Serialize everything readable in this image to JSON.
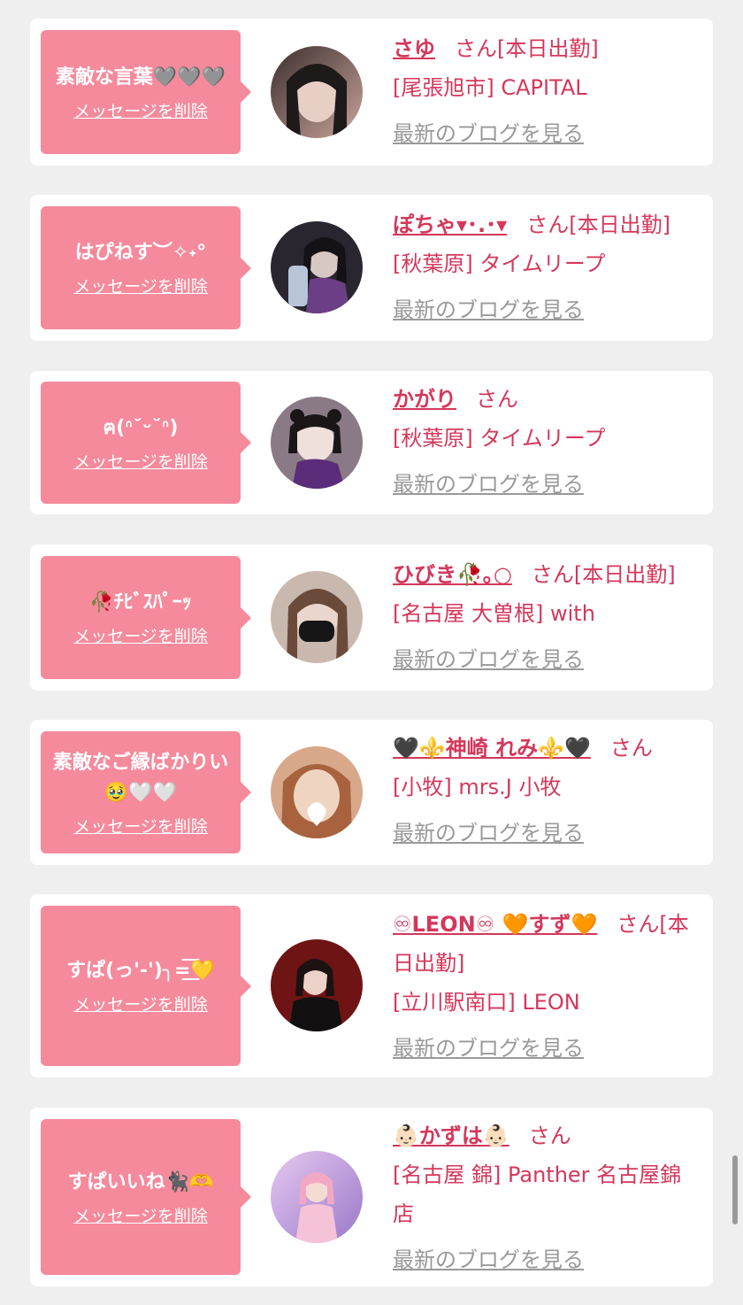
{
  "theme": {
    "accent": "#d4375b",
    "bubble": "#f58a9c",
    "link_gray": "#999999",
    "background": "#efefef"
  },
  "labels": {
    "delete": "メッセージを削除",
    "blog": "最新のブログを見る"
  },
  "items": [
    {
      "message": "素敵な言葉🩶🩶🩶",
      "name": "さゆ",
      "suffix": "さん[本日出勤]",
      "shop": "[尾張旭市] CAPITAL"
    },
    {
      "message": "はぴねす︶✧˖°",
      "name": "ぽちゃ▾･.･▾",
      "suffix": "さん[本日出勤]",
      "shop": "[秋葉原] タイムリープ"
    },
    {
      "message": "ฅ(ᐢ˘ᵕ˘ᐢ)",
      "name": "かがり",
      "suffix": "さん",
      "shop": "[秋葉原] タイムリープ"
    },
    {
      "message": "🥀ﾁﾋﾞｽﾊﾟｰｯ",
      "name": "ひびき🥀｡○",
      "suffix": "さん[本日出勤]",
      "shop": "[名古屋 大曽根] with"
    },
    {
      "message": "素敵なご縁ばかりい🥹🤍🤍",
      "name": "🖤⚜️神崎 れみ⚜️🖤",
      "suffix": "さん",
      "shop": "[小牧] mrs.J 小牧"
    },
    {
      "message": "すぱ(っ'-')╮=͟͟͞͞💛",
      "name": "♾LEON♾ 🧡すず🧡",
      "suffix": "さん[本日出勤]",
      "shop": "[立川駅南口] LEON"
    },
    {
      "message": "すぱいいね🐈‍⬛🫶",
      "name": "👶🏻かずは👶🏻",
      "suffix": "さん",
      "shop": "[名古屋 錦] Panther 名古屋錦店"
    }
  ]
}
